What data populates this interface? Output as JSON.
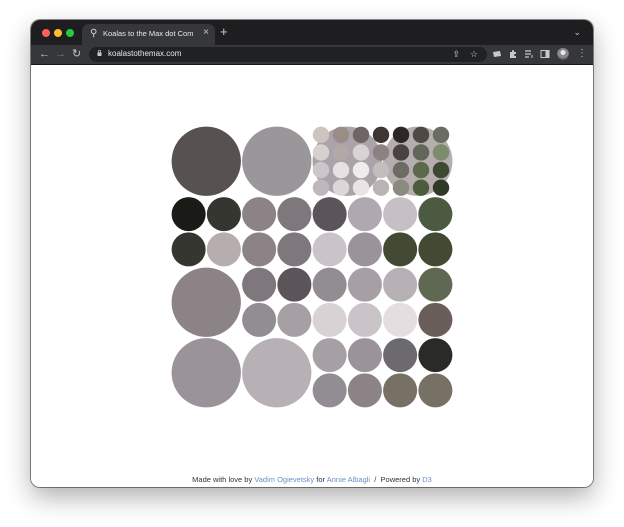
{
  "browser": {
    "tab": {
      "title": "Koalas to the Max dot Com",
      "favicon": "koala-icon"
    },
    "address": {
      "url": "koalastothemax.com"
    }
  },
  "footer": {
    "made_with_love": "Made with love by",
    "author": "Vadim Ogievetsky",
    "for_word": "for",
    "recipient": "Annie Albagli",
    "separator": "/",
    "powered_by": "Powered by",
    "library": "D3"
  },
  "colors": {
    "tabbar": "#1e1e20",
    "toolbar": "#36373a",
    "link": "#6b8fc4",
    "light": "#e3dde0"
  },
  "mosaic": {
    "grid": [
      "ABBBBBBBBBBB",
      "BBBBBBBBBBBB",
      "CCCCCCCCCCCC",
      "CCCCCCCCCCCC",
      "DDDDDDDDDDDD",
      "DDDDDDDDDDDD",
      "EEEEEEEEEEEE",
      "EEEEEEEEEEEE"
    ],
    "palette": {
      "a": "#57524f",
      "b": "#9a969a",
      "c": "#aaa3aa",
      "d": "#b5adae",
      "e": "#1a1a16",
      "f": "#35362f",
      "g": "#8b8386",
      "h": "#7e777b",
      "i": "#5b5459",
      "j": "#b0a8b0",
      "k": "#c6c0c6",
      "l": "#8a8486",
      "m": "#9a939a",
      "n": "#a6a0a4",
      "o": "#434a33",
      "p": "#777064",
      "q": "#cac3c8",
      "r": "#928c93",
      "s": "#d8d2d4",
      "t": "#e5dde0",
      "u": "#b7b1b6",
      "v": "#6d6a6f",
      "w": "#4b5a40",
      "x": "#5f6852",
      "y": "#2a2b26",
      "z": "#6b5e5a"
    },
    "layout": [
      "a a a a b b b b c c c c d d d d",
      "a a a a b b b b c c c c d d d d",
      "a a a a b b b b c c c c d d d d",
      "a a a a b b b b c c c c d d d d",
      "e e f f g g h h i i j j k k w w",
      "e e f f g g h h i i j j k k w w",
      "f f d d g g h h q q m m o o o o",
      "f f d d g g h h q q m m o o o o",
      "g g g g h h i i r r n n u u x x",
      "g g g g h h i i r r n n u u x x",
      "g g g g r r n n s s q q t t z z",
      "g g g g r r n n s s q q t t z z",
      "m m m m u u u u n n m m v v y y",
      "m m m m u u u u n n m m v v y y",
      "m m m m u u u u r r g g p p p p",
      "m m m m u u u u r r g g p p p p"
    ]
  }
}
